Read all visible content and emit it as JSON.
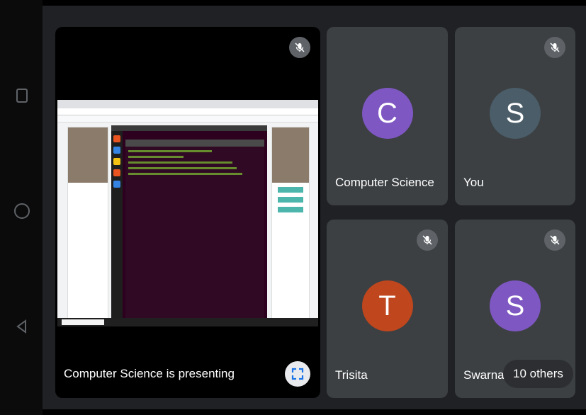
{
  "presenter": {
    "label": "Computer Science is presenting",
    "mic_icon": "mic-off-icon",
    "fullscreen_icon": "fullscreen-icon"
  },
  "participants": [
    {
      "name": "Computer Science",
      "initial": "C",
      "color": "#7e57c2"
    },
    {
      "name": "You",
      "initial": "S",
      "color": "#4a5d68"
    },
    {
      "name": "Trisita",
      "initial": "T",
      "color": "#c0461d"
    },
    {
      "name": "Swarnal",
      "initial": "S",
      "color": "#7e57c2"
    }
  ],
  "others_label": "10 others",
  "android_nav": [
    "recents-icon",
    "home-icon",
    "back-icon"
  ]
}
